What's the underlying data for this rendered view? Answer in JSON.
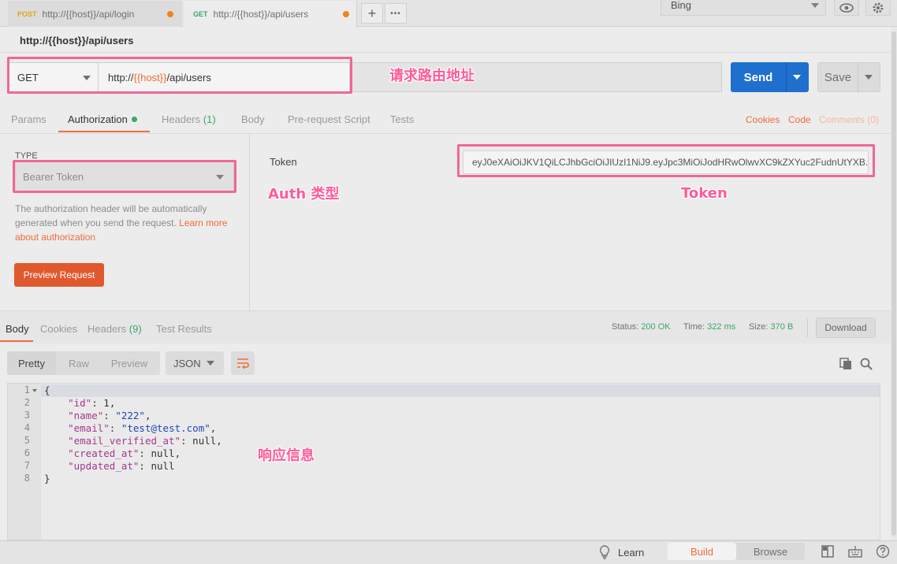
{
  "tabs": [
    {
      "method": "POST",
      "method_color": "#e5a31a",
      "url": "http://{{host}}/api/login"
    },
    {
      "method": "GET",
      "method_color": "#3aa866",
      "url": "http://{{host}}/api/users"
    }
  ],
  "tab_actions": {
    "new_tab": "+",
    "more": "•••"
  },
  "environment": {
    "selected": "Bing"
  },
  "request": {
    "title": "http://{{host}}/api/users",
    "method": "GET",
    "url_prefix": "http://",
    "url_var": "{{host}}",
    "url_suffix": "/api/users",
    "send_label": "Send",
    "save_label": "Save"
  },
  "request_tabs": {
    "params": "Params",
    "authorization": "Authorization",
    "headers": "Headers",
    "headers_count": "(1)",
    "body": "Body",
    "prerequest": "Pre-request Script",
    "tests": "Tests",
    "cookies": "Cookies",
    "code": "Code",
    "comments": "Comments (0)"
  },
  "auth": {
    "type_label": "TYPE",
    "type_value": "Bearer Token",
    "description": "The authorization header will be automatically generated when you send the request. ",
    "learn_link": "Learn more about authorization",
    "preview_button": "Preview Request",
    "token_label": "Token",
    "token_value": "eyJ0eXAiOiJKV1QiLCJhbGciOiJIUzI1NiJ9.eyJpc3MiOiJodHRwOlwvXC9kZXYuc2FudnUtYXB..."
  },
  "response": {
    "tabs": {
      "body": "Body",
      "cookies": "Cookies",
      "headers": "Headers",
      "headers_count": "(9)",
      "test_results": "Test Results"
    },
    "status_label": "Status:",
    "status_value": "200 OK",
    "time_label": "Time:",
    "time_value": "322 ms",
    "size_label": "Size:",
    "size_value": "370 B",
    "download": "Download",
    "formats": {
      "pretty": "Pretty",
      "raw": "Raw",
      "preview": "Preview",
      "type": "JSON"
    },
    "line_numbers": [
      "1",
      "2",
      "3",
      "4",
      "5",
      "6",
      "7",
      "8"
    ],
    "json": {
      "open": "{",
      "close": "}",
      "fields": [
        {
          "key": "\"id\"",
          "value": "1",
          "sep": ","
        },
        {
          "key": "\"name\"",
          "value": "\"222\"",
          "sep": ","
        },
        {
          "key": "\"email\"",
          "value": "\"test@test.com\"",
          "sep": ","
        },
        {
          "key": "\"email_verified_at\"",
          "value": "null",
          "sep": ","
        },
        {
          "key": "\"created_at\"",
          "value": "null",
          "sep": ","
        },
        {
          "key": "\"updated_at\"",
          "value": "null",
          "sep": ""
        }
      ]
    }
  },
  "annotations": {
    "route": "请求路由地址",
    "auth_type": "Auth 类型",
    "token": "Token",
    "response": "响应信息"
  },
  "statusbar": {
    "learn": "Learn",
    "build": "Build",
    "browse": "Browse"
  },
  "colors": {
    "accent": "#f26b3a",
    "send": "#1f6fce",
    "success": "#3aa866",
    "highlight": "#f0669a"
  }
}
